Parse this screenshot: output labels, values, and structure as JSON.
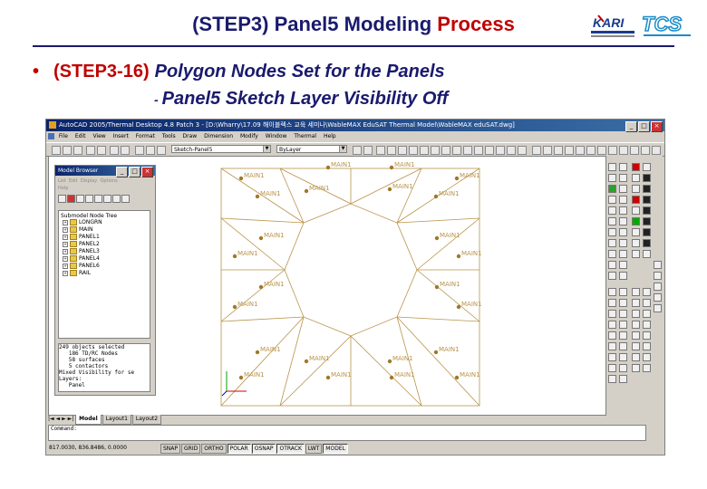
{
  "slide": {
    "title_part1": "(STEP3) Panel5 Modeling ",
    "title_part2": "Process",
    "bullet": "•",
    "step": "(STEP3-16)",
    "step_desc": "Polygon Nodes Set for the Panels",
    "sub_dash": "-",
    "sub_desc": "Panel5 Sketch Layer Visibility Off"
  },
  "app": {
    "title": "AutoCAD 2005/Thermal Desktop 4.8 Patch 3 - [D:\\Wharry\\17.09 해이블렉스 교육 세미나\\WableMAX EduSAT Thermal Model\\WableMAX eduSAT.dwg]",
    "menus": [
      "File",
      "Edit",
      "View",
      "Insert",
      "Format",
      "Tools",
      "Draw",
      "Dimension",
      "Modify",
      "Window",
      "Thermal",
      "Help"
    ],
    "layer_combo": "Sketch-Panel5",
    "linetype_combo": "ByLayer"
  },
  "browser": {
    "title": "Model Browser",
    "menus": [
      "List",
      "Edit",
      "Display",
      "Options",
      "Help"
    ],
    "tree_header": "Submodel Node Tree",
    "tree_items": [
      "LONGRN",
      "MAIN",
      "PANEL1",
      "PANEL2",
      "PANEL3",
      "PANEL4",
      "PANEL6",
      "RAIL"
    ],
    "info": "249 objects selected\n   186 TD/RC Nodes\n   58 surfaces\n   5 contactors\nMixed Visibility for se\nLayers:\n   Panel"
  },
  "drawing": {
    "node_label": "MAIN1"
  },
  "tabs": [
    "Model",
    "Layout1",
    "Layout2"
  ],
  "command": "Command:",
  "status": {
    "coords": "817.0030, 836.8486, 0.0000",
    "buttons": [
      "SNAP",
      "GRID",
      "ORTHO",
      "POLAR",
      "OSNAP",
      "OTRACK",
      "LWT",
      "MODEL"
    ]
  },
  "colors": {
    "title_blue": "#1a1a6e",
    "accent_red": "#c00000",
    "drawing_line": "#b8944a",
    "node_dot": "#a07828"
  }
}
